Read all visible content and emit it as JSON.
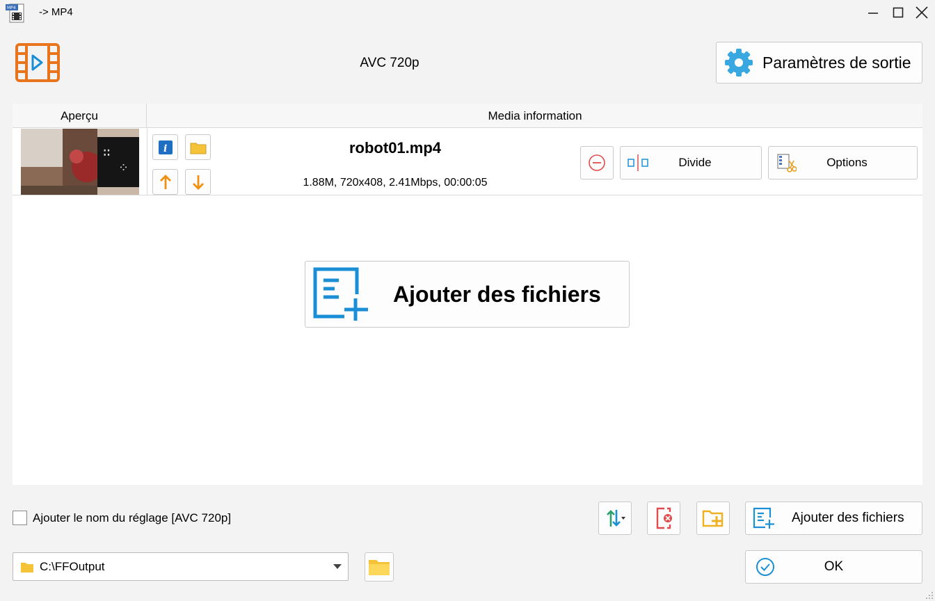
{
  "window": {
    "title": "-> MP4",
    "app_icon": "mp4-file-icon",
    "controls": [
      "minimize-icon",
      "maximize-icon",
      "close-icon"
    ]
  },
  "header": {
    "format_icon": "video-film-icon",
    "preset_name": "AVC 720p",
    "output_settings_label": "Paramètres de sortie",
    "output_settings_icon": "gear-icon"
  },
  "table": {
    "columns": [
      "Aperçu",
      "Media information"
    ],
    "rows": [
      {
        "file_name": "robot01.mp4",
        "meta": "1.88M, 720x408, 2.41Mbps, 00:00:05",
        "divide_label": "Divide",
        "options_label": "Options"
      }
    ]
  },
  "main": {
    "add_files_label": "Ajouter des fichiers"
  },
  "bottom": {
    "append_preset_label": "Ajouter le nom du réglage [AVC 720p]",
    "append_preset_checked": false,
    "add_files_label": "Ajouter des fichiers",
    "output_path": "C:\\FFOutput",
    "ok_label": "OK"
  },
  "colors": {
    "accent_blue": "#1a8fd6",
    "orange": "#e8741e",
    "folder_yellow": "#f5c338",
    "remove_red": "#e24b4b"
  }
}
